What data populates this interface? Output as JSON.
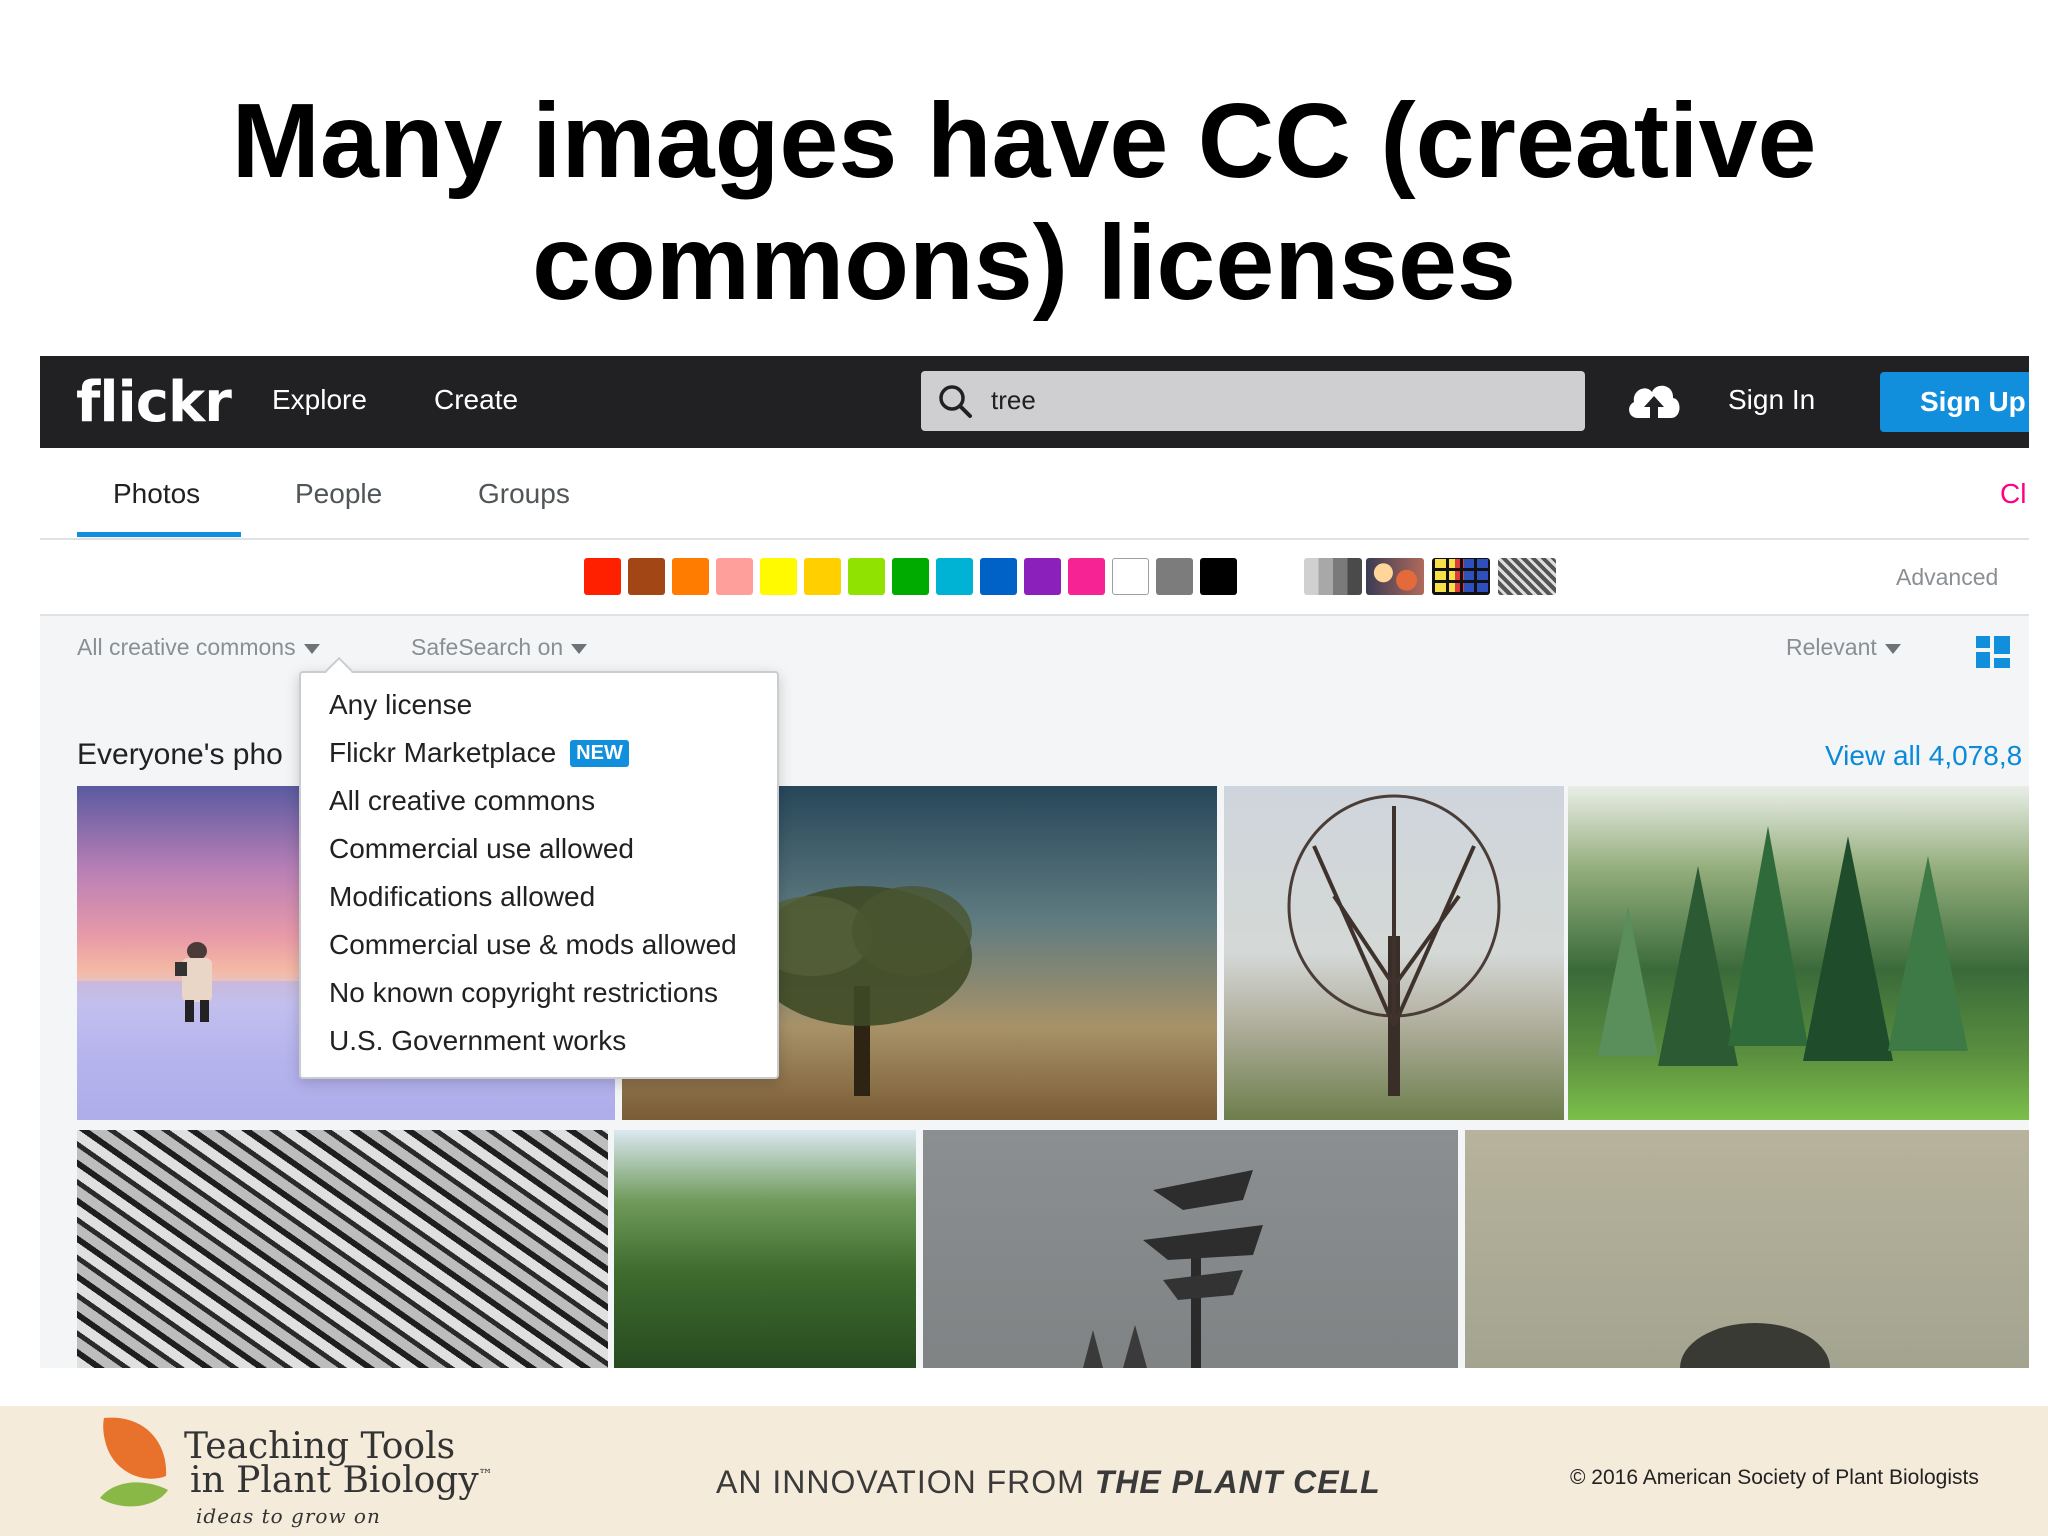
{
  "slide": {
    "title_line1": "Many images have CC (creative",
    "title_line2": "commons) licenses"
  },
  "flickr": {
    "logo": "flickr",
    "nav": {
      "explore": "Explore",
      "create": "Create"
    },
    "search": {
      "value": "tree",
      "icon": "search-icon"
    },
    "upload_icon": "cloud-upload-icon",
    "sign_in": "Sign In",
    "sign_up": "Sign Up",
    "tabs": [
      {
        "label": "Photos",
        "active": true
      },
      {
        "label": "People",
        "active": false
      },
      {
        "label": "Groups",
        "active": false
      }
    ],
    "tab_clear_partial": "Cl",
    "colors": [
      "#ff2000",
      "#a24615",
      "#ff7c00",
      "#ff9f9c",
      "#fffa00",
      "#ffcf00",
      "#90e200",
      "#00ab00",
      "#00b2d4",
      "#0062c6",
      "#8c20ba",
      "#f52394",
      "#ffffff",
      "#7c7c7c",
      "#000000"
    ],
    "advanced": "Advanced",
    "filters": {
      "license": "All creative commons",
      "safesearch": "SafeSearch on",
      "sort": "Relevant"
    },
    "view_icon": "grid-view-icon",
    "section_title": "Everyone's pho",
    "view_all": "View all 4,078,8",
    "license_menu": [
      {
        "label": "Any license"
      },
      {
        "label": "Flickr Marketplace",
        "badge": "NEW"
      },
      {
        "label": "All creative commons"
      },
      {
        "label": "Commercial use allowed"
      },
      {
        "label": "Modifications allowed"
      },
      {
        "label": "Commercial use & mods allowed"
      },
      {
        "label": "No known copyright restrictions"
      },
      {
        "label": "U.S. Government works"
      }
    ]
  },
  "footer": {
    "brand_line1": "Teaching Tools",
    "brand_line2": "in Plant Biology",
    "tm": "™",
    "tagline": "ideas to grow on",
    "innovation_prefix": "AN INNOVATION FROM ",
    "innovation_journal": "THE PLANT CELL",
    "copyright": "©  2016 American Society of Plant Biologists"
  }
}
